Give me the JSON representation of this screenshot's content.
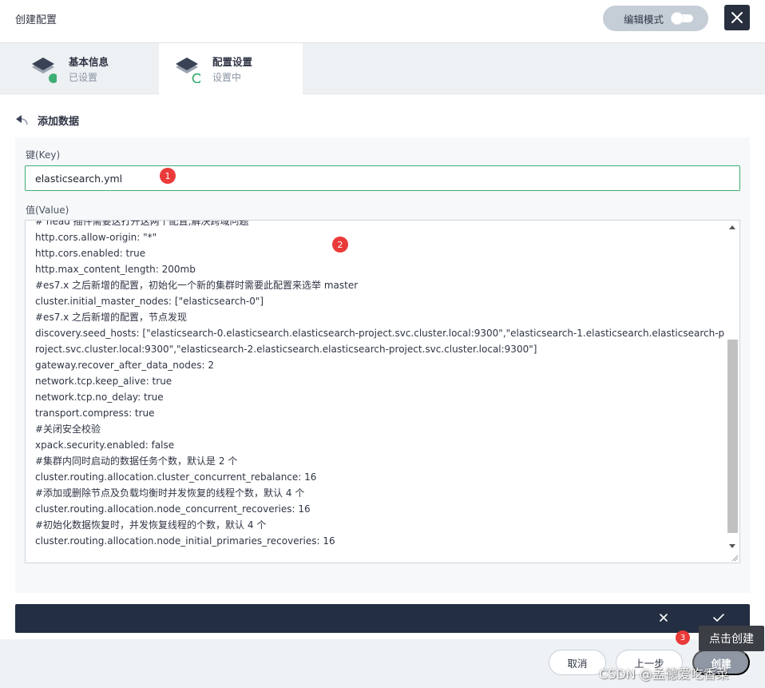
{
  "header": {
    "title": "创建配置",
    "mode_label": "编辑模式"
  },
  "steps": [
    {
      "name": "基本信息",
      "status": "已设置"
    },
    {
      "name": "配置设置",
      "status": "设置中"
    }
  ],
  "section": {
    "title": "添加数据"
  },
  "form": {
    "key_label": "键(Key)",
    "key_value": "elasticsearch.yml",
    "value_label": "值(Value)",
    "value_lines": [
      "# head 插件需要这打开这两个配置,解决跨域问题",
      "http.cors.allow-origin: \"*\"",
      "http.cors.enabled: true",
      "http.max_content_length: 200mb",
      "#es7.x 之后新增的配置，初始化一个新的集群时需要此配置来选举 master",
      "cluster.initial_master_nodes: [\"elasticsearch-0\"]",
      "#es7.x 之后新增的配置，节点发现",
      "discovery.seed_hosts: [\"elasticsearch-0.elasticsearch.elasticsearch-project.svc.cluster.local:9300\",\"elasticsearch-1.elasticsearch.elasticsearch-project.svc.cluster.local:9300\",\"elasticsearch-2.elasticsearch.elasticsearch-project.svc.cluster.local:9300\"]",
      "gateway.recover_after_data_nodes: 2",
      "network.tcp.keep_alive: true",
      "network.tcp.no_delay: true",
      "transport.compress: true",
      "#关闭安全校验",
      "xpack.security.enabled: false",
      "#集群内同时启动的数据任务个数，默认是 2 个",
      "cluster.routing.allocation.cluster_concurrent_rebalance: 16",
      "#添加或删除节点及负载均衡时并发恢复的线程个数，默认 4 个",
      "cluster.routing.allocation.node_concurrent_recoveries: 16",
      "#初始化数据恢复时，并发恢复线程的个数，默认 4 个",
      "cluster.routing.allocation.node_initial_primaries_recoveries: 16"
    ]
  },
  "footer": {
    "cancel_label": "取消",
    "prev_label": "上一步",
    "create_label": "创建"
  },
  "annotations": {
    "badge1": "1",
    "badge2": "2",
    "badge3": "3",
    "tooltip": "点击创建"
  },
  "watermark": "CSDN @孟德爱吃香菜",
  "colors": {
    "accent_green": "#3fae74",
    "dark_bar": "#242e42",
    "badge_red": "#ea3a3a"
  }
}
